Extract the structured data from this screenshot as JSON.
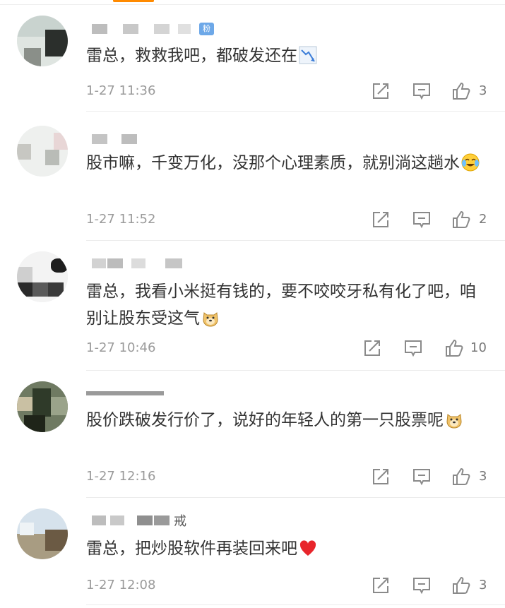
{
  "comments": [
    {
      "badge": "粉",
      "name_tail": "",
      "text": "雷总，救救我吧，都破发还在",
      "emoji": "chart-down-icon",
      "time": "1-27 11:36",
      "likes": "3"
    },
    {
      "badge": "",
      "name_tail": "",
      "text": "股市嘛，千变万化，没那个心理素质，就别淌这趟水",
      "emoji": "laugh-cry-icon",
      "time": "1-27 11:52",
      "likes": "2"
    },
    {
      "badge": "",
      "name_tail": "",
      "text": "雷总，我看小米挺有钱的，要不咬咬牙私有化了吧，咱别让股东受这气",
      "emoji": "doge-icon",
      "time": "1-27 10:46",
      "likes": "10"
    },
    {
      "badge": "",
      "name_tail": "",
      "text": "股价跌破发行价了，说好的年轻人的第一只股票呢",
      "emoji": "doge-icon",
      "time": "1-27 12:16",
      "likes": "3"
    },
    {
      "badge": "",
      "name_tail": "戒",
      "text": "雷总，把炒股软件再装回来吧",
      "emoji": "heart-icon",
      "time": "1-27 12:08",
      "likes": "3"
    }
  ]
}
